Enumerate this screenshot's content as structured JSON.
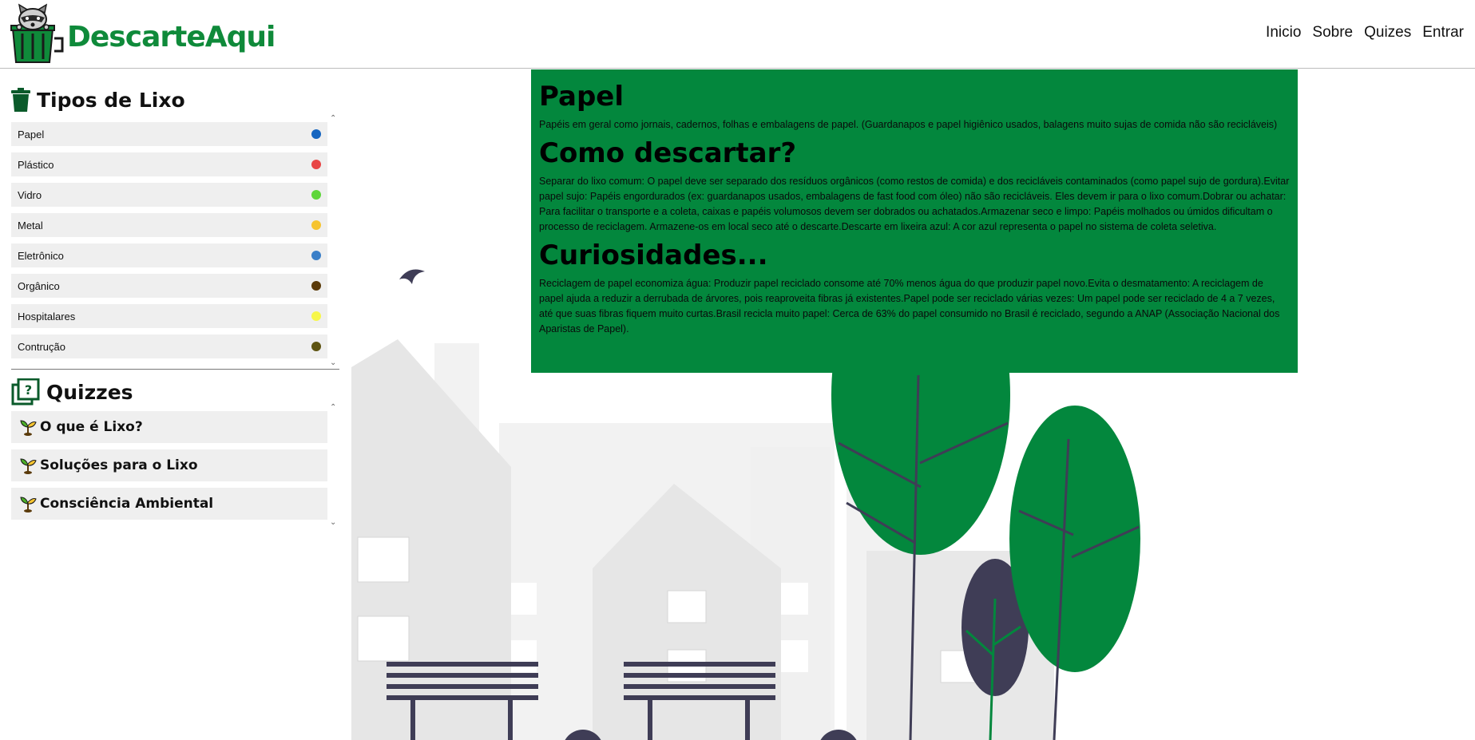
{
  "header": {
    "logo_text": "DescarteAqui",
    "nav": [
      "Inicio",
      "Sobre",
      "Quizes",
      "Entrar"
    ]
  },
  "sidebar": {
    "types_title": "Tipos de Lixo",
    "types": [
      {
        "label": "Papel",
        "color": "#1565c0"
      },
      {
        "label": "Plástico",
        "color": "#e84545"
      },
      {
        "label": "Vidro",
        "color": "#5ed63a"
      },
      {
        "label": "Metal",
        "color": "#f6c430"
      },
      {
        "label": "Eletrônico",
        "color": "#3a7fc8"
      },
      {
        "label": "Orgânico",
        "color": "#5a3a0a"
      },
      {
        "label": "Hospitalares",
        "color": "#f7f74a"
      },
      {
        "label": "Contrução",
        "color": "#5e5412"
      }
    ],
    "quizzes_title": "Quizzes",
    "quizzes": [
      "O que é Lixo?",
      "Soluções para o Lixo",
      "Consciência Ambiental"
    ]
  },
  "content": {
    "title": "Papel",
    "description": "Papéis em geral como jornais, cadernos, folhas e embalagens de papel. (Guardanapos e papel higiênico usados, balagens muito sujas de comida não são recicláveis)",
    "how_title": "Como descartar?",
    "how_text": "Separar do lixo comum: O papel deve ser separado dos resíduos orgânicos (como restos de comida) e dos recicláveis contaminados (como papel sujo de gordura).Evitar papel sujo: Papéis engordurados (ex: guardanapos usados, embalagens de fast food com óleo) não são recicláveis. Eles devem ir para o lixo comum.Dobrar ou achatar: Para facilitar o transporte e a coleta, caixas e papéis volumosos devem ser dobrados ou achatados.Armazenar seco e limpo: Papéis molhados ou úmidos dificultam o processo de reciclagem. Armazene-os em local seco até o descarte.Descarte em lixeira azul: A cor azul representa o papel no sistema de coleta seletiva.",
    "curio_title": "Curiosidades...",
    "curio_text": "Reciclagem de papel economiza água: Produzir papel reciclado consome até 70% menos água do que produzir papel novo.Evita o desmatamento: A reciclagem de papel ajuda a reduzir a derrubada de árvores, pois reaproveita fibras já existentes.Papel pode ser reciclado várias vezes: Um papel pode ser reciclado de 4 a 7 vezes, até que suas fibras fiquem muito curtas.Brasil recicla muito papel: Cerca de 63% do papel consumido no Brasil é reciclado, segundo a ANAP (Associação Nacional dos Aparistas de Papel)."
  },
  "colors": {
    "brand_green": "#0f8a3a",
    "panel_green": "#03873d"
  }
}
